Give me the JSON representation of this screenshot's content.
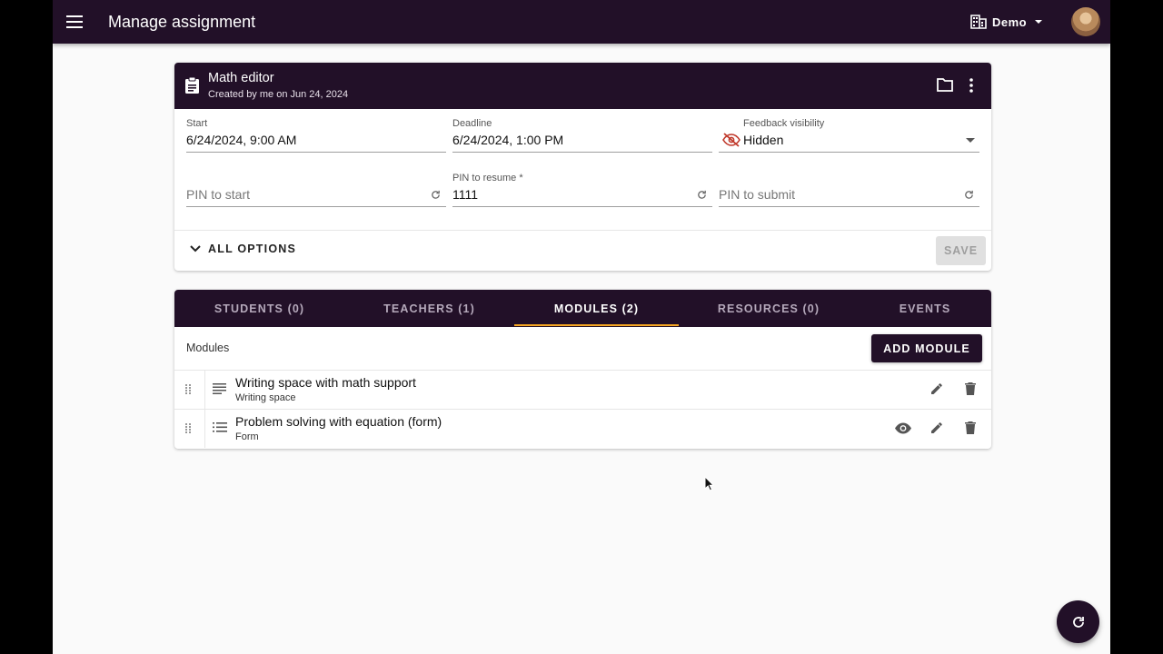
{
  "header": {
    "page_title": "Manage assignment",
    "org_name": "Demo",
    "icons": {
      "menu": "menu-icon",
      "org": "building-icon",
      "dropdown": "arrow-drop-down-icon"
    }
  },
  "assignment": {
    "title": "Math editor",
    "subtitle": "Created by me on Jun 24, 2024",
    "fields": {
      "start": {
        "label": "Start",
        "value": "6/24/2024, 9:00 AM"
      },
      "deadline": {
        "label": "Deadline",
        "value": "6/24/2024, 1:00 PM"
      },
      "feedback": {
        "label": "Feedback visibility",
        "value": "Hidden"
      },
      "pin_start": {
        "placeholder": "PIN to start"
      },
      "pin_resume": {
        "label": "PIN to resume *",
        "value": "1111"
      },
      "pin_submit": {
        "placeholder": "PIN to submit"
      }
    },
    "all_options_label": "ALL OPTIONS",
    "save_label": "SAVE"
  },
  "tabs": [
    {
      "label": "STUDENTS (0)"
    },
    {
      "label": "TEACHERS (1)"
    },
    {
      "label": "MODULES (2)"
    },
    {
      "label": "RESOURCES (0)"
    },
    {
      "label": "EVENTS"
    }
  ],
  "active_tab": "MODULES (2)",
  "modules": {
    "header": "Modules",
    "add_label": "ADD MODULE",
    "items": [
      {
        "name": "Writing space with math support",
        "kind": "Writing space",
        "icon": "notes-icon"
      },
      {
        "name": "Problem solving with equation (form)",
        "kind": "Form",
        "icon": "list-icon"
      }
    ]
  },
  "colors": {
    "brand": "#221028",
    "accent": "#f5a623",
    "background": "#fafafa"
  }
}
